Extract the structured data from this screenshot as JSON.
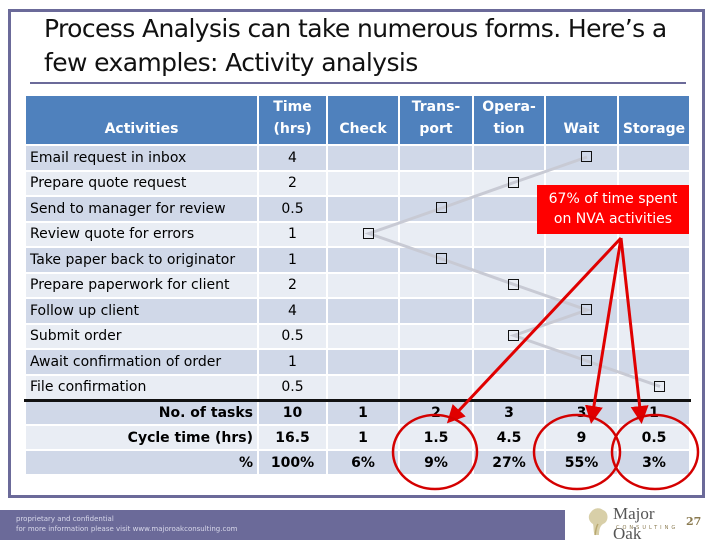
{
  "slide": {
    "title": "Process Analysis can take numerous forms.  Here’s a few examples: Activity analysis",
    "page_number": "27",
    "colors": {
      "frame": "#6b6a99",
      "header_bg": "#4f81bd",
      "row_dark": "#d0d8e8",
      "row_light": "#e9edf4",
      "highlight": "#ff0000",
      "flow_line": "#c8cad4"
    }
  },
  "table": {
    "headers": {
      "activities": "Activities",
      "time_line1": "Time",
      "time_line2": "(hrs)",
      "check": "Check",
      "transport_line1": "Trans-",
      "transport_line2": "port",
      "operation_line1": "Opera-",
      "operation_line2": "tion",
      "wait": "Wait",
      "storage": "Storage"
    },
    "rows": [
      {
        "activity": "Email request in inbox",
        "time": "4",
        "type": "Wait"
      },
      {
        "activity": "Prepare quote request",
        "time": "2",
        "type": "Operation"
      },
      {
        "activity": "Send to manager for review",
        "time": "0.5",
        "type": "Transport"
      },
      {
        "activity": "Review quote for errors",
        "time": "1",
        "type": "Check"
      },
      {
        "activity": "Take paper back to originator",
        "time": "1",
        "type": "Transport"
      },
      {
        "activity": "Prepare paperwork for client",
        "time": "2",
        "type": "Operation"
      },
      {
        "activity": "Follow up client",
        "time": "4",
        "type": "Wait"
      },
      {
        "activity": "Submit order",
        "time": "0.5",
        "type": "Operation"
      },
      {
        "activity": "Await confirmation of order",
        "time": "1",
        "type": "Wait"
      },
      {
        "activity": "File confirmation",
        "time": "0.5",
        "type": "Storage"
      }
    ],
    "summary": [
      {
        "label": "No. of tasks",
        "total": "10",
        "check": "1",
        "transport": "2",
        "operation": "3",
        "wait": "3",
        "storage": "1"
      },
      {
        "label": "Cycle time (hrs)",
        "total": "16.5",
        "check": "1",
        "transport": "1.5",
        "operation": "4.5",
        "wait": "9",
        "storage": "0.5"
      },
      {
        "label": "%",
        "total": "100%",
        "check": "6%",
        "transport": "9%",
        "operation": "27%",
        "wait": "55%",
        "storage": "3%"
      }
    ]
  },
  "callout": {
    "line1": "67% of time spent",
    "line2": "on NVA activities",
    "highlighted_columns": [
      "Transport",
      "Wait",
      "Storage"
    ]
  },
  "footer": {
    "line1": "proprietary and confidential",
    "line2": "for more information please visit www.majoroakconsulting.com",
    "logo_name": "Major Oak",
    "logo_sub": "CONSULTING"
  }
}
